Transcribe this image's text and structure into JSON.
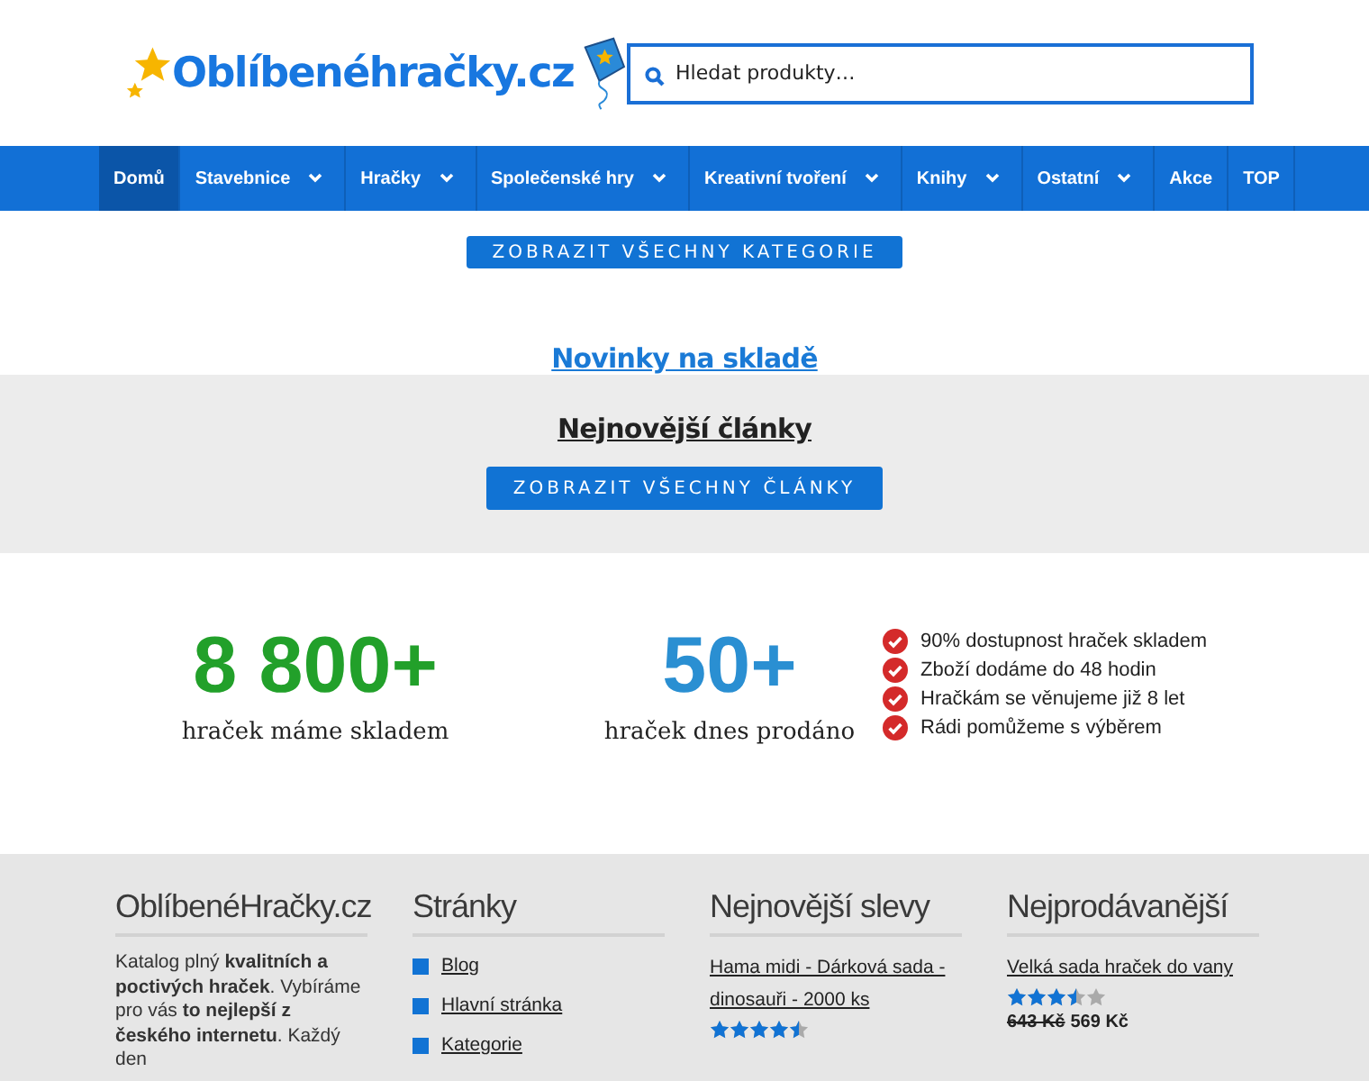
{
  "header": {
    "logo": "Oblíbenéhračky.cz",
    "search": {
      "placeholder": "Hledat produkty…"
    }
  },
  "nav": [
    {
      "label": "Domů",
      "selected": true,
      "dropdown": false
    },
    {
      "label": "Stavebnice",
      "selected": false,
      "dropdown": true
    },
    {
      "label": "Hračky",
      "selected": false,
      "dropdown": true
    },
    {
      "label": "Společenské hry",
      "selected": false,
      "dropdown": true
    },
    {
      "label": "Kreativní tvoření",
      "selected": false,
      "dropdown": true
    },
    {
      "label": "Knihy",
      "selected": false,
      "dropdown": true
    },
    {
      "label": "Ostatní",
      "selected": false,
      "dropdown": true
    },
    {
      "label": "Akce",
      "selected": false,
      "dropdown": false
    },
    {
      "label": "TOP",
      "selected": false,
      "dropdown": false
    }
  ],
  "categories_button": "ZOBRAZIT VŠECHNY KATEGORIE",
  "new_in_stock_link": "Novinky na skladě",
  "articles": {
    "heading": "Nejnovější články",
    "button": "ZOBRAZIT VŠECHNY ČLÁNKY"
  },
  "stats": [
    {
      "value": "8 800+",
      "label": "hraček máme skladem",
      "color": "#22a02a"
    },
    {
      "value": "50+",
      "label": "hraček dnes prodáno",
      "color": "#2a8fd2"
    }
  ],
  "benefits": [
    "90% dostupnost hraček skladem",
    "Zboží dodáme do 48 hodin",
    "Hračkám se věnujeme již 8 let",
    "Rádi pomůžeme s výběrem"
  ],
  "footer": {
    "about": {
      "title": "OblíbenéHračky.cz",
      "text": "Katalog plný **kvalitních a poctivých hraček**. Vybíráme pro vás **to nejlepší z českého internetu**. Každý den"
    },
    "pages": {
      "title": "Stránky",
      "links": [
        "Blog",
        "Hlavní stránka",
        "Kategorie"
      ]
    },
    "discounts": {
      "title": "Nejnovější slevy",
      "products": [
        {
          "name": "Hama midi - Dárková sada - dinosauři - 2000 ks",
          "stars": 4.5
        }
      ]
    },
    "bestsellers": {
      "title": "Nejprodávanější",
      "products": [
        {
          "name": "Velká sada hraček do vany",
          "stars": 3.5,
          "old_price": "643 Kč",
          "price": "569 Kč"
        }
      ]
    }
  }
}
